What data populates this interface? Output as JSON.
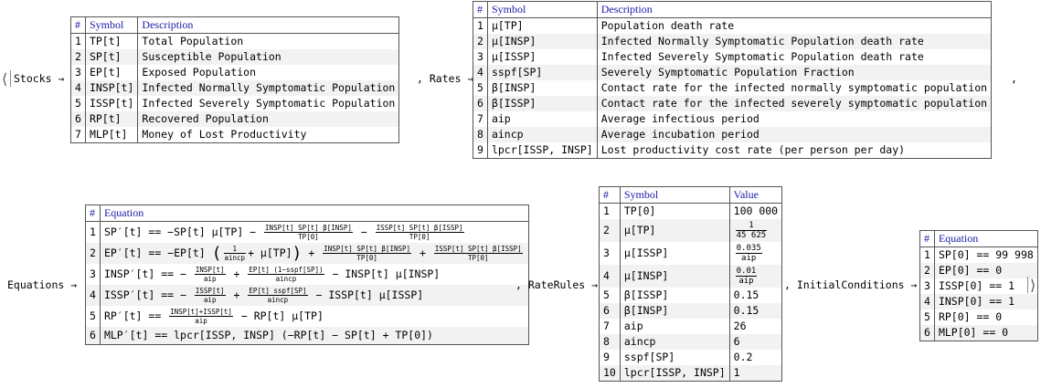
{
  "association": {
    "open": "⟨",
    "close": "⟩"
  },
  "keys": {
    "stocks": "Stocks",
    "rates": "Rates",
    "equations": "Equations",
    "rate_rules": "RateRules",
    "initial_conditions": "InitialConditions",
    "arrow": "→",
    "comma": ","
  },
  "stocks": {
    "headers": [
      "#",
      "Symbol",
      "Description"
    ],
    "rows": [
      {
        "n": "1",
        "symbol": "TP[t]",
        "desc": "Total Population"
      },
      {
        "n": "2",
        "symbol": "SP[t]",
        "desc": "Susceptible Population"
      },
      {
        "n": "3",
        "symbol": "EP[t]",
        "desc": "Exposed Population"
      },
      {
        "n": "4",
        "symbol": "INSP[t]",
        "desc": "Infected Normally Symptomatic Population"
      },
      {
        "n": "5",
        "symbol": "ISSP[t]",
        "desc": "Infected Severely Symptomatic Population"
      },
      {
        "n": "6",
        "symbol": "RP[t]",
        "desc": "Recovered Population"
      },
      {
        "n": "7",
        "symbol": "MLP[t]",
        "desc": "Money of Lost Productivity"
      }
    ]
  },
  "rates": {
    "headers": [
      "#",
      "Symbol",
      "Description"
    ],
    "rows": [
      {
        "n": "1",
        "symbol": "μ[TP]",
        "desc": "Population death rate"
      },
      {
        "n": "2",
        "symbol": "μ[INSP]",
        "desc": "Infected Normally Symptomatic Population death rate"
      },
      {
        "n": "3",
        "symbol": "μ[ISSP]",
        "desc": "Infected Severely Symptomatic Population death rate"
      },
      {
        "n": "4",
        "symbol": "sspf[SP]",
        "desc": "Severely Symptomatic Population Fraction"
      },
      {
        "n": "5",
        "symbol": "β[INSP]",
        "desc": "Contact rate for the infected normally symptomatic population"
      },
      {
        "n": "6",
        "symbol": "β[ISSP]",
        "desc": "Contact rate for the infected severely symptomatic population"
      },
      {
        "n": "7",
        "symbol": "aip",
        "desc": "Average infectious period"
      },
      {
        "n": "8",
        "symbol": "aincp",
        "desc": "Average incubation period"
      },
      {
        "n": "9",
        "symbol": "lpcr[ISSP, INSP]",
        "desc": "Lost productivity cost rate (per person per day)"
      }
    ]
  },
  "equations": {
    "headers": [
      "#",
      "Equation"
    ],
    "rows": [
      {
        "n": "1",
        "lhs": "SP′[t] == −SP[t] μ[TP] −",
        "f1n": "INSP[t] SP[t] β[INSP]",
        "f1d": "TP[0]",
        "mid": "−",
        "f2n": "ISSP[t] SP[t] β[ISSP]",
        "f2d": "TP[0]"
      },
      {
        "n": "2",
        "lhs": "EP′[t] == −EP[t]",
        "paren_l": "(",
        "f0n": "1",
        "f0d": "aincp",
        "pmid": "+ μ[TP]",
        "paren_r": ")",
        "plus": "+",
        "f1n": "INSP[t] SP[t] β[INSP]",
        "f1d": "TP[0]",
        "mid": "+",
        "f2n": "ISSP[t] SP[t] β[ISSP]",
        "f2d": "TP[0]"
      },
      {
        "n": "3",
        "lhs": "INSP′[t] == −",
        "f1n": "INSP[t]",
        "f1d": "aip",
        "mid": "+",
        "f2n": "EP[t] (1−sspf[SP])",
        "f2d": "aincp",
        "tail": "− INSP[t] μ[INSP]"
      },
      {
        "n": "4",
        "lhs": "ISSP′[t] == −",
        "f1n": "ISSP[t]",
        "f1d": "aip",
        "mid": "+",
        "f2n": "EP[t] sspf[SP]",
        "f2d": "aincp",
        "tail": "− ISSP[t] μ[ISSP]"
      },
      {
        "n": "5",
        "lhs": "RP′[t] ==",
        "f1n": "INSP[t]+ISSP[t]",
        "f1d": "aip",
        "tail": "− RP[t] μ[TP]"
      },
      {
        "n": "6",
        "lhs": "MLP′[t] == lpcr[ISSP, INSP] (−RP[t] − SP[t] + TP[0])"
      }
    ]
  },
  "rate_rules": {
    "headers": [
      "#",
      "Symbol",
      "Value"
    ],
    "rows": [
      {
        "n": "1",
        "symbol": "TP[0]",
        "value": "100 000"
      },
      {
        "n": "2",
        "symbol": "μ[TP]",
        "value_num": "1",
        "value_den": "45 625"
      },
      {
        "n": "3",
        "symbol": "μ[ISSP]",
        "value_num": "0.035",
        "value_den": "aip"
      },
      {
        "n": "4",
        "symbol": "μ[INSP]",
        "value_num": "0.01",
        "value_den": "aip"
      },
      {
        "n": "5",
        "symbol": "β[ISSP]",
        "value": "0.15"
      },
      {
        "n": "6",
        "symbol": "β[INSP]",
        "value": "0.15"
      },
      {
        "n": "7",
        "symbol": "aip",
        "value": "26"
      },
      {
        "n": "8",
        "symbol": "aincp",
        "value": "6"
      },
      {
        "n": "9",
        "symbol": "sspf[SP]",
        "value": "0.2"
      },
      {
        "n": "10",
        "symbol": "lpcr[ISSP, INSP]",
        "value": "1"
      }
    ]
  },
  "initial_conditions": {
    "headers": [
      "#",
      "Equation"
    ],
    "rows": [
      {
        "n": "1",
        "eq": "SP[0] == 99 998"
      },
      {
        "n": "2",
        "eq": "EP[0] == 0"
      },
      {
        "n": "3",
        "eq": "ISSP[0] == 1"
      },
      {
        "n": "4",
        "eq": "INSP[0] == 1"
      },
      {
        "n": "5",
        "eq": "RP[0] == 0"
      },
      {
        "n": "6",
        "eq": "MLP[0] == 0"
      }
    ]
  }
}
